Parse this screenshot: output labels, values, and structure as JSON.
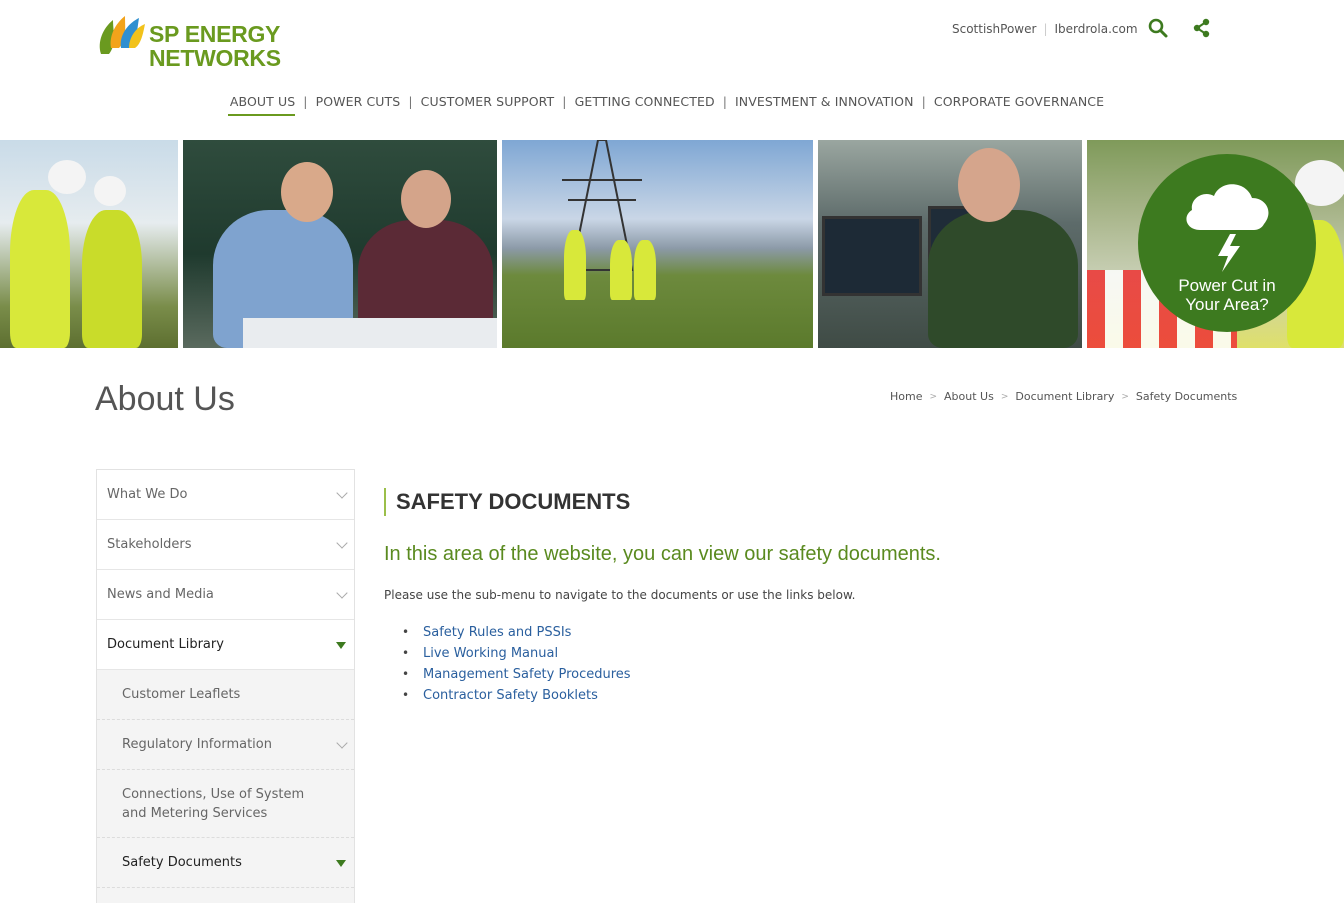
{
  "brand": {
    "line1": "SP ENERGY",
    "line2": "NETWORKS",
    "green": "#6a9a1f",
    "dark_green": "#3d7a1f"
  },
  "top_links": {
    "scottishpower": "ScottishPower",
    "iberdrola": "Iberdrola.com"
  },
  "main_nav": [
    {
      "label": "ABOUT US",
      "active": true
    },
    {
      "label": "POWER CUTS"
    },
    {
      "label": "CUSTOMER SUPPORT"
    },
    {
      "label": "GETTING CONNECTED"
    },
    {
      "label": "INVESTMENT & INNOVATION"
    },
    {
      "label": "CORPORATE GOVERNANCE"
    }
  ],
  "nav_divider": "|",
  "power_cut": {
    "line1": "Power Cut in",
    "line2": "Your Area?"
  },
  "page_title": "About Us",
  "breadcrumb": [
    "Home",
    "About Us",
    "Document Library",
    "Safety Documents"
  ],
  "breadcrumb_sep": ">",
  "sidebar": {
    "items": [
      "What We Do",
      "Stakeholders",
      "News and Media",
      "Document Library"
    ],
    "sub_items": [
      "Customer Leaflets",
      "Regulatory Information",
      "Connections, Use of System and Metering Services",
      "Safety Documents"
    ]
  },
  "content": {
    "title": "SAFETY DOCUMENTS",
    "intro": "In this area of the website, you can view our safety documents.",
    "paragraph": "Please use the sub-menu to navigate to the documents or use the links below.",
    "links": [
      "Safety Rules and PSSIs",
      "Live Working Manual",
      "Management Safety Procedures",
      "Contractor Safety Booklets"
    ]
  }
}
